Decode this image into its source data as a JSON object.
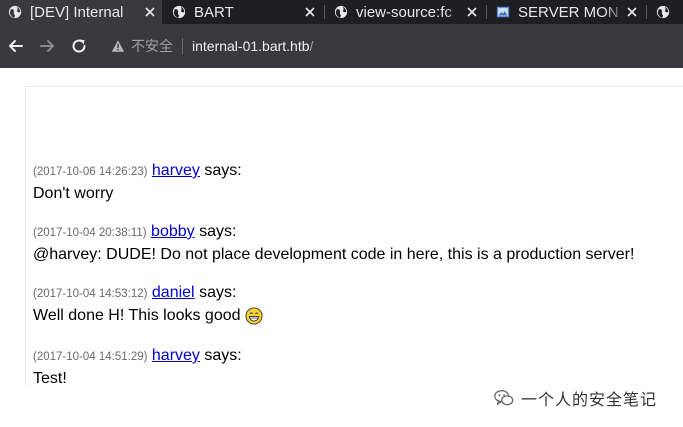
{
  "browser": {
    "tabs": [
      {
        "title": "[DEV] Internal",
        "icon": "globe-icon",
        "active": true
      },
      {
        "title": "BART",
        "icon": "globe-icon",
        "active": false
      },
      {
        "title": "view-source:fc",
        "icon": "globe-icon",
        "active": false
      },
      {
        "title": "SERVER MON",
        "icon": "image-icon",
        "active": false
      },
      {
        "title": "",
        "icon": "globe-icon",
        "active": false
      }
    ],
    "security_label": "不安全",
    "url_host": "internal-01.bart.htb",
    "url_path": "/"
  },
  "chat": {
    "messages": [
      {
        "time": "(2017-10-06 14:26:23)",
        "user": "harvey",
        "says": "says:",
        "text": "Don't worry",
        "emoji": ""
      },
      {
        "time": "(2017-10-04 20:38:11)",
        "user": "bobby",
        "says": "says:",
        "text": "@harvey: DUDE! Do not place development code in here, this is a production server!",
        "emoji": ""
      },
      {
        "time": "(2017-10-04 14:53:12)",
        "user": "daniel",
        "says": "says:",
        "text": "Well done H! This looks good",
        "emoji": "grin-emoji-icon"
      },
      {
        "time": "(2017-10-04 14:51:29)",
        "user": "harvey",
        "says": "says:",
        "text": "Test!",
        "emoji": ""
      }
    ]
  },
  "watermark": {
    "text": "一个人的安全笔记"
  },
  "colors": {
    "tabbar_bg": "#1f1f23",
    "toolbar_bg": "#3a3a3e",
    "link": "#0000cc",
    "timestamp": "#6a6a6a"
  }
}
